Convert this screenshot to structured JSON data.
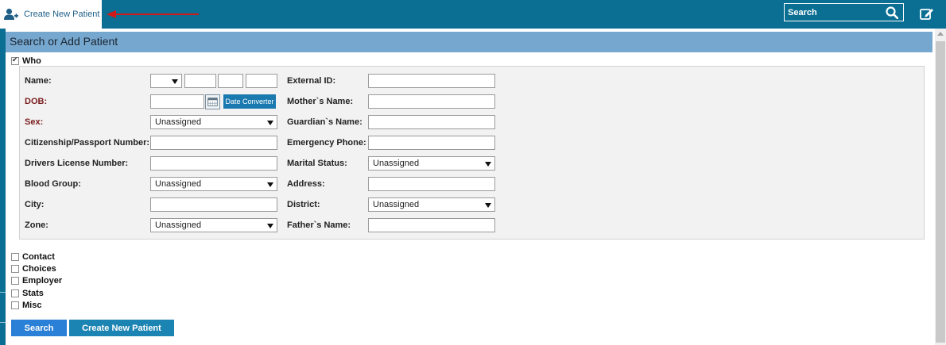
{
  "topbar": {
    "create_label": "Create New Patient",
    "search_placeholder": "Search",
    "icons": [
      "add-user-icon",
      "search-icon",
      "edit-icon"
    ]
  },
  "panel": {
    "title": "Search or Add Patient",
    "who_label": "Who",
    "who_checked": true
  },
  "form": {
    "name_label": "Name:",
    "dob_label": "DOB:",
    "date_converter_label": "Date Converter",
    "sex_label": "Sex:",
    "sex_value": "Unassigned",
    "citizenship_label": "Citizenship/Passport Number:",
    "drivers_license_label": "Drivers License Number:",
    "blood_group_label": "Blood Group:",
    "blood_group_value": "Unassigned",
    "city_label": "City:",
    "zone_label": "Zone:",
    "zone_value": "Unassigned",
    "external_id_label": "External ID:",
    "mothers_name_label": "Mother`s Name:",
    "guardians_name_label": "Guardian`s Name:",
    "emergency_phone_label": "Emergency Phone:",
    "marital_status_label": "Marital Status:",
    "marital_status_value": "Unassigned",
    "address_label": "Address:",
    "district_label": "District:",
    "district_value": "Unassigned",
    "fathers_name_label": "Father`s Name:"
  },
  "sections": [
    "Contact",
    "Choices",
    "Employer",
    "Stats",
    "Misc"
  ],
  "buttons": {
    "search": "Search",
    "create": "Create New Patient"
  },
  "colors": {
    "topbar": "#0a6f92",
    "panel_header": "#76a7cf",
    "required_label": "#7a1c1c",
    "search_button": "#2a7fd6",
    "create_button": "#1c84b3"
  }
}
